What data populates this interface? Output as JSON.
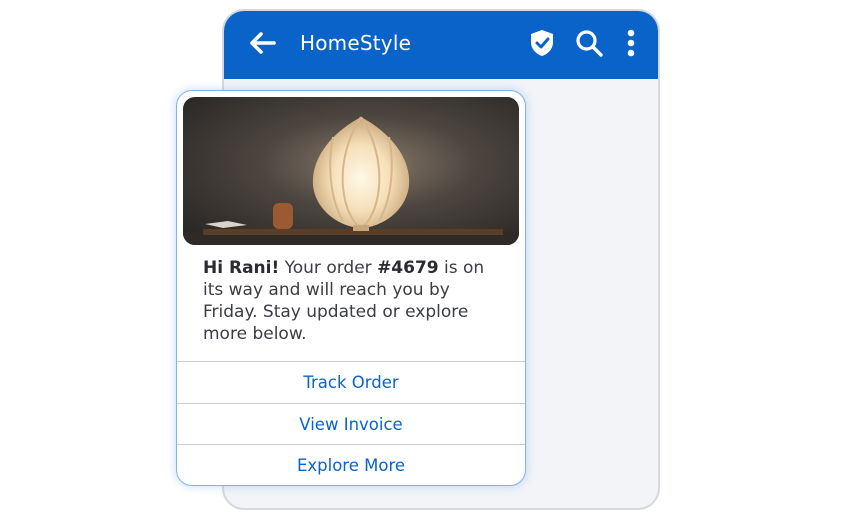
{
  "app": {
    "title": "HomeStyle",
    "brand_color": "#0a63c9",
    "icons": [
      "arrow-left-icon",
      "shield-check-icon",
      "search-icon",
      "more-vertical-icon"
    ]
  },
  "message": {
    "greeting": "Hi Rani!",
    "text_before_order": " Your order ",
    "order_number": "#4679",
    "text_after_order": " is on its way and will reach you by Friday. Stay updated or explore more below.",
    "image": "lamp-photo"
  },
  "actions": [
    {
      "label": "Track Order"
    },
    {
      "label": "View Invoice"
    },
    {
      "label": "Explore More"
    }
  ]
}
